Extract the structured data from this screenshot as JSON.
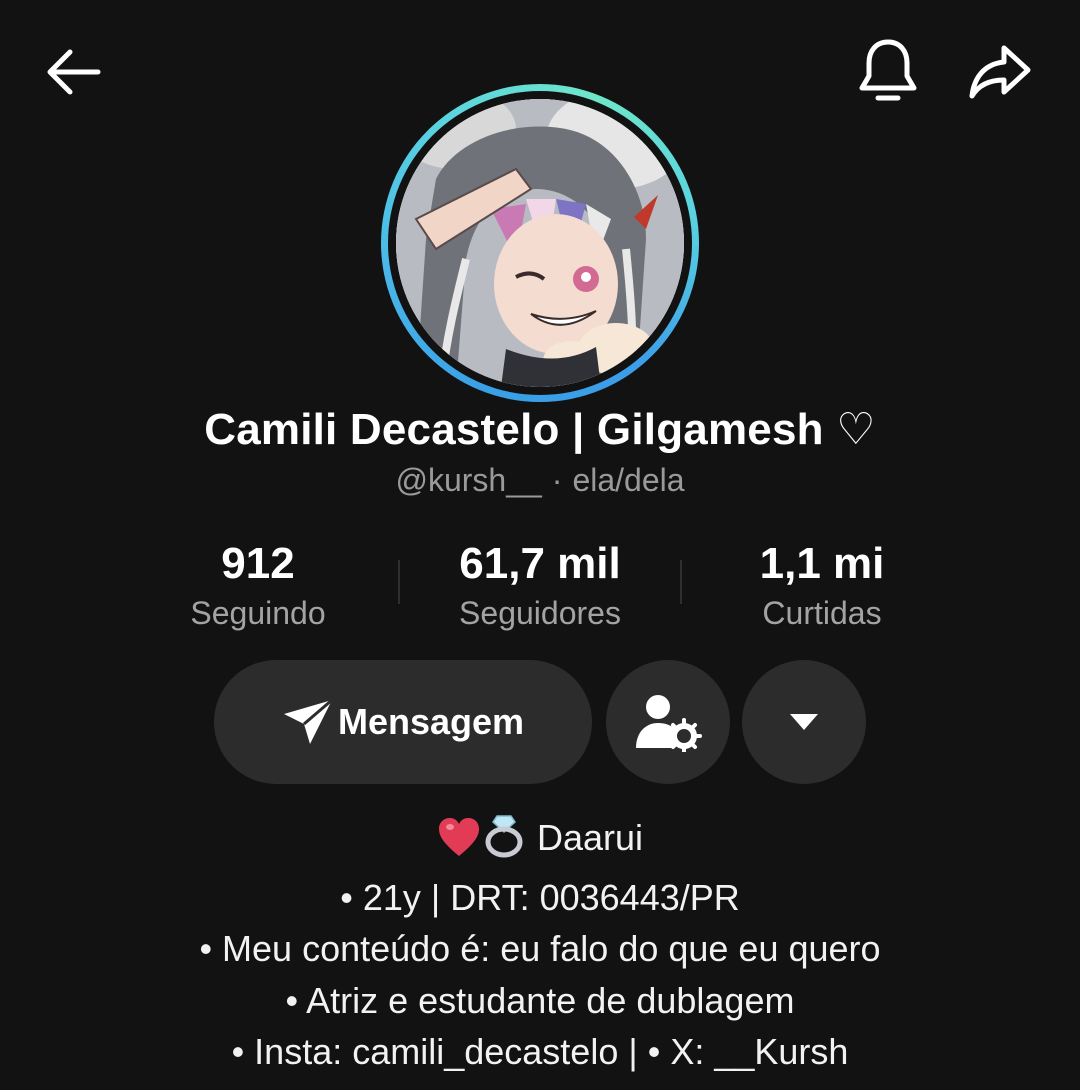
{
  "header": {
    "back_icon": "arrow-left-icon",
    "bell_icon": "bell-icon",
    "share_icon": "share-arrow-icon"
  },
  "profile": {
    "name": "Camili Decastelo | Gilgamesh ♡",
    "handle": "@kursh__",
    "separator": "·",
    "pronouns": "ela/dela",
    "avatar_ring_colors": [
      "#3aa0e6",
      "#6fe6c9"
    ]
  },
  "stats": [
    {
      "value": "912",
      "label": "Seguindo"
    },
    {
      "value": "61,7 mil",
      "label": "Seguidores"
    },
    {
      "value": "1,1 mi",
      "label": "Curtidas"
    }
  ],
  "actions": {
    "message_label": "Mensagem",
    "message_icon": "send-icon",
    "add_friend_icon": "user-settings-icon",
    "more_icon": "caret-down-icon"
  },
  "bio": {
    "line1_text": "Daarui",
    "line1_emojis": [
      "heart-emoji",
      "ring-emoji"
    ],
    "line2": "• 21y | DRT: 0036443/PR",
    "line3": "• Meu conteúdo é: eu falo do que eu quero",
    "line4": "• Atriz e estudante de dublagem",
    "line5": "• Insta: camili_decastelo | • X: __Kursh"
  },
  "colors": {
    "background": "#121212",
    "button_bg": "#2c2c2c",
    "secondary_text": "#9a9a9a"
  }
}
